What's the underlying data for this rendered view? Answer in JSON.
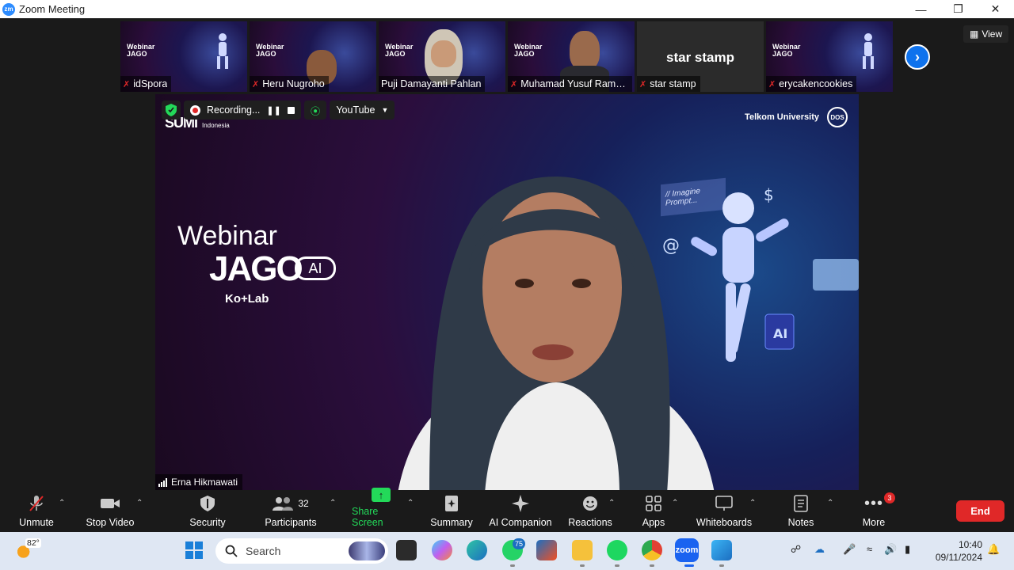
{
  "window": {
    "title": "Zoom Meeting",
    "app_icon": "zm"
  },
  "view_button": {
    "label": "View"
  },
  "participants_strip": [
    {
      "name": "idSpora",
      "kind": "webinar",
      "muted": true
    },
    {
      "name": "Heru Nugroho",
      "kind": "webinar",
      "muted": true
    },
    {
      "name": "Puji Damayanti Pahlan",
      "kind": "webinar",
      "muted": false
    },
    {
      "name": "Muhamad Yusuf Rama...",
      "kind": "webinar",
      "muted": true
    },
    {
      "name": "star stamp",
      "kind": "plain",
      "display": "star stamp",
      "muted": true
    },
    {
      "name": "erycakencookies",
      "kind": "webinar",
      "muted": true
    }
  ],
  "recording": {
    "label": "Recording...",
    "stream_target": "YouTube"
  },
  "main_video": {
    "speaker": "Erna Hikmawati",
    "slide": {
      "brand_left": "SUMI",
      "brand_left_small": "Indonesia",
      "brand_right": "Telkom University",
      "webinar": "Webinar",
      "jago": "JAGO",
      "ai": "AI",
      "kolab": "Ko+Lab",
      "imagine": "// Imagine Prompt..."
    }
  },
  "toolbar": {
    "unmute": "Unmute",
    "stop_video": "Stop Video",
    "security": "Security",
    "participants": "Participants",
    "participants_count": "32",
    "share_screen": "Share Screen",
    "summary": "Summary",
    "ai_companion": "AI Companion",
    "reactions": "Reactions",
    "apps": "Apps",
    "whiteboards": "Whiteboards",
    "notes": "Notes",
    "more": "More",
    "more_badge": "3",
    "end": "End"
  },
  "taskbar": {
    "weather_temp": "82°",
    "search_placeholder": "Search",
    "whatsapp_badge": "75",
    "time": "10:40",
    "date": "09/11/2024"
  },
  "colors": {
    "zoom_blue": "#0e72ed",
    "share_green": "#23d959",
    "end_red": "#e02828"
  }
}
